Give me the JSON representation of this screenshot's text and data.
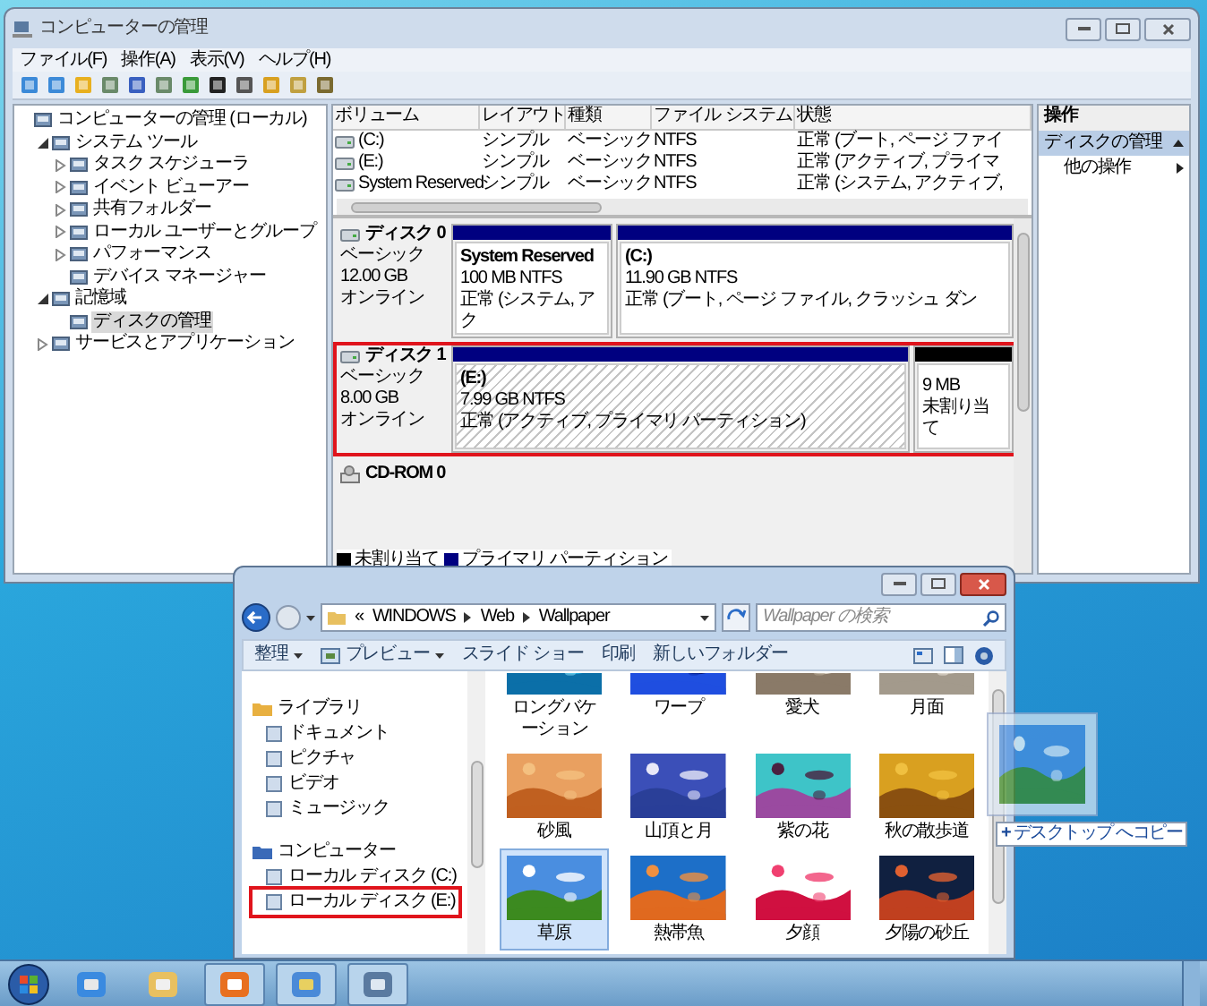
{
  "management_window": {
    "title": "コンピューターの管理",
    "menu": [
      "ファイル(F)",
      "操作(A)",
      "表示(V)",
      "ヘルプ(H)"
    ],
    "tree": [
      {
        "label": "コンピューターの管理 (ローカル)",
        "selected": false,
        "children": [
          {
            "label": "システム ツール",
            "expanded": true,
            "selected": false,
            "children": [
              {
                "label": "タスク スケジューラ",
                "expanded": false,
                "selected": false
              },
              {
                "label": "イベント ビューアー",
                "expanded": false,
                "selected": false
              },
              {
                "label": "共有フォルダー",
                "expanded": false,
                "selected": false
              },
              {
                "label": "ローカル ユーザーとグループ",
                "expanded": false,
                "selected": false
              },
              {
                "label": "パフォーマンス",
                "expanded": false,
                "selected": false
              },
              {
                "label": "デバイス マネージャー",
                "selected": false
              }
            ]
          },
          {
            "label": "記憶域",
            "expanded": true,
            "selected": false,
            "children": [
              {
                "label": "ディスクの管理",
                "selected": true
              }
            ]
          },
          {
            "label": "サービスとアプリケーション",
            "expanded": false,
            "selected": false
          }
        ]
      }
    ],
    "volumes": {
      "columns": [
        "ボリューム",
        "レイアウト",
        "種類",
        "ファイル システム",
        "状態"
      ],
      "rows": [
        [
          "(C:)",
          "シンプル",
          "ベーシック",
          "NTFS",
          "正常 (ブート, ページ ファイ"
        ],
        [
          "(E:)",
          "シンプル",
          "ベーシック",
          "NTFS",
          "正常 (アクティブ, プライマ"
        ],
        [
          "System Reserved",
          "シンプル",
          "ベーシック",
          "NTFS",
          "正常 (システム, アクティブ,"
        ]
      ]
    },
    "disks": [
      {
        "name": "ディスク 0",
        "type": "ベーシック",
        "size": "12.00 GB",
        "status": "オンライン",
        "highlighted": false,
        "partitions": [
          {
            "kind": "primary",
            "name": "System Reserved",
            "size": "100 MB NTFS",
            "status": "正常 (システム, アク",
            "selected": false
          },
          {
            "kind": "primary",
            "name": "(C:)",
            "size": "11.90 GB NTFS",
            "status": "正常 (ブート, ページ ファイル, クラッシュ ダン",
            "selected": false
          }
        ]
      },
      {
        "name": "ディスク 1",
        "type": "ベーシック",
        "size": "8.00 GB",
        "status": "オンライン",
        "highlighted": true,
        "partitions": [
          {
            "kind": "primary",
            "name": "(E:)",
            "size": "7.99 GB NTFS",
            "status": "正常 (アクティブ, プライマリ パーティション)",
            "selected": true
          },
          {
            "kind": "unallocated",
            "size": "9 MB",
            "status": "未割り当て",
            "selected": false
          }
        ]
      }
    ],
    "cdrom": "CD-ROM 0",
    "legend": [
      {
        "label": "未割り当て",
        "color": "#000000"
      },
      {
        "label": "プライマリ パーティション",
        "color": "#000080"
      }
    ],
    "actions": {
      "title": "操作",
      "section": "ディスクの管理",
      "items": [
        "他の操作"
      ]
    }
  },
  "explorer": {
    "path_prefix": "«",
    "path": [
      "WINDOWS",
      "Web",
      "Wallpaper"
    ],
    "search_placeholder": "Wallpaper の検索",
    "toolbar": [
      {
        "label": "整理",
        "icon": false,
        "dropdown": true
      },
      {
        "label": "プレビュー",
        "icon": true,
        "dropdown": true
      },
      {
        "label": "スライド ショー",
        "icon": false,
        "dropdown": false
      },
      {
        "label": "印刷",
        "icon": false,
        "dropdown": false
      },
      {
        "label": "新しいフォルダー",
        "icon": false,
        "dropdown": false
      }
    ],
    "nav": [
      {
        "label": "ライブラリ",
        "highlighted": false,
        "children": [
          {
            "label": "ドキュメント",
            "highlighted": false
          },
          {
            "label": "ピクチャ",
            "highlighted": false
          },
          {
            "label": "ビデオ",
            "highlighted": false
          },
          {
            "label": "ミュージック",
            "highlighted": false
          }
        ]
      },
      {
        "label": "コンピューター",
        "highlighted": false,
        "children": [
          {
            "label": "ローカル ディスク (C:)",
            "highlighted": false
          },
          {
            "label": "ローカル ディスク (E:)",
            "highlighted": true
          }
        ]
      }
    ],
    "thumbnails": [
      {
        "label": "ロングバケーション",
        "cropped": true,
        "selected": false
      },
      {
        "label": "ワープ",
        "cropped": true,
        "selected": false
      },
      {
        "label": "愛犬",
        "cropped": true,
        "selected": false
      },
      {
        "label": "月面",
        "cropped": true,
        "selected": false
      },
      {
        "label": "砂風",
        "cropped": false,
        "selected": false
      },
      {
        "label": "山頂と月",
        "cropped": false,
        "selected": false
      },
      {
        "label": "紫の花",
        "cropped": false,
        "selected": false
      },
      {
        "label": "秋の散歩道",
        "cropped": false,
        "selected": false
      },
      {
        "label": "草原",
        "cropped": false,
        "selected": true
      },
      {
        "label": "熱帯魚",
        "cropped": false,
        "selected": false
      },
      {
        "label": "夕顔",
        "cropped": false,
        "selected": false
      },
      {
        "label": "夕陽の砂丘",
        "cropped": false,
        "selected": false
      }
    ]
  },
  "drag": {
    "badge": "+",
    "tooltip": "デスクトップ へコピー"
  }
}
